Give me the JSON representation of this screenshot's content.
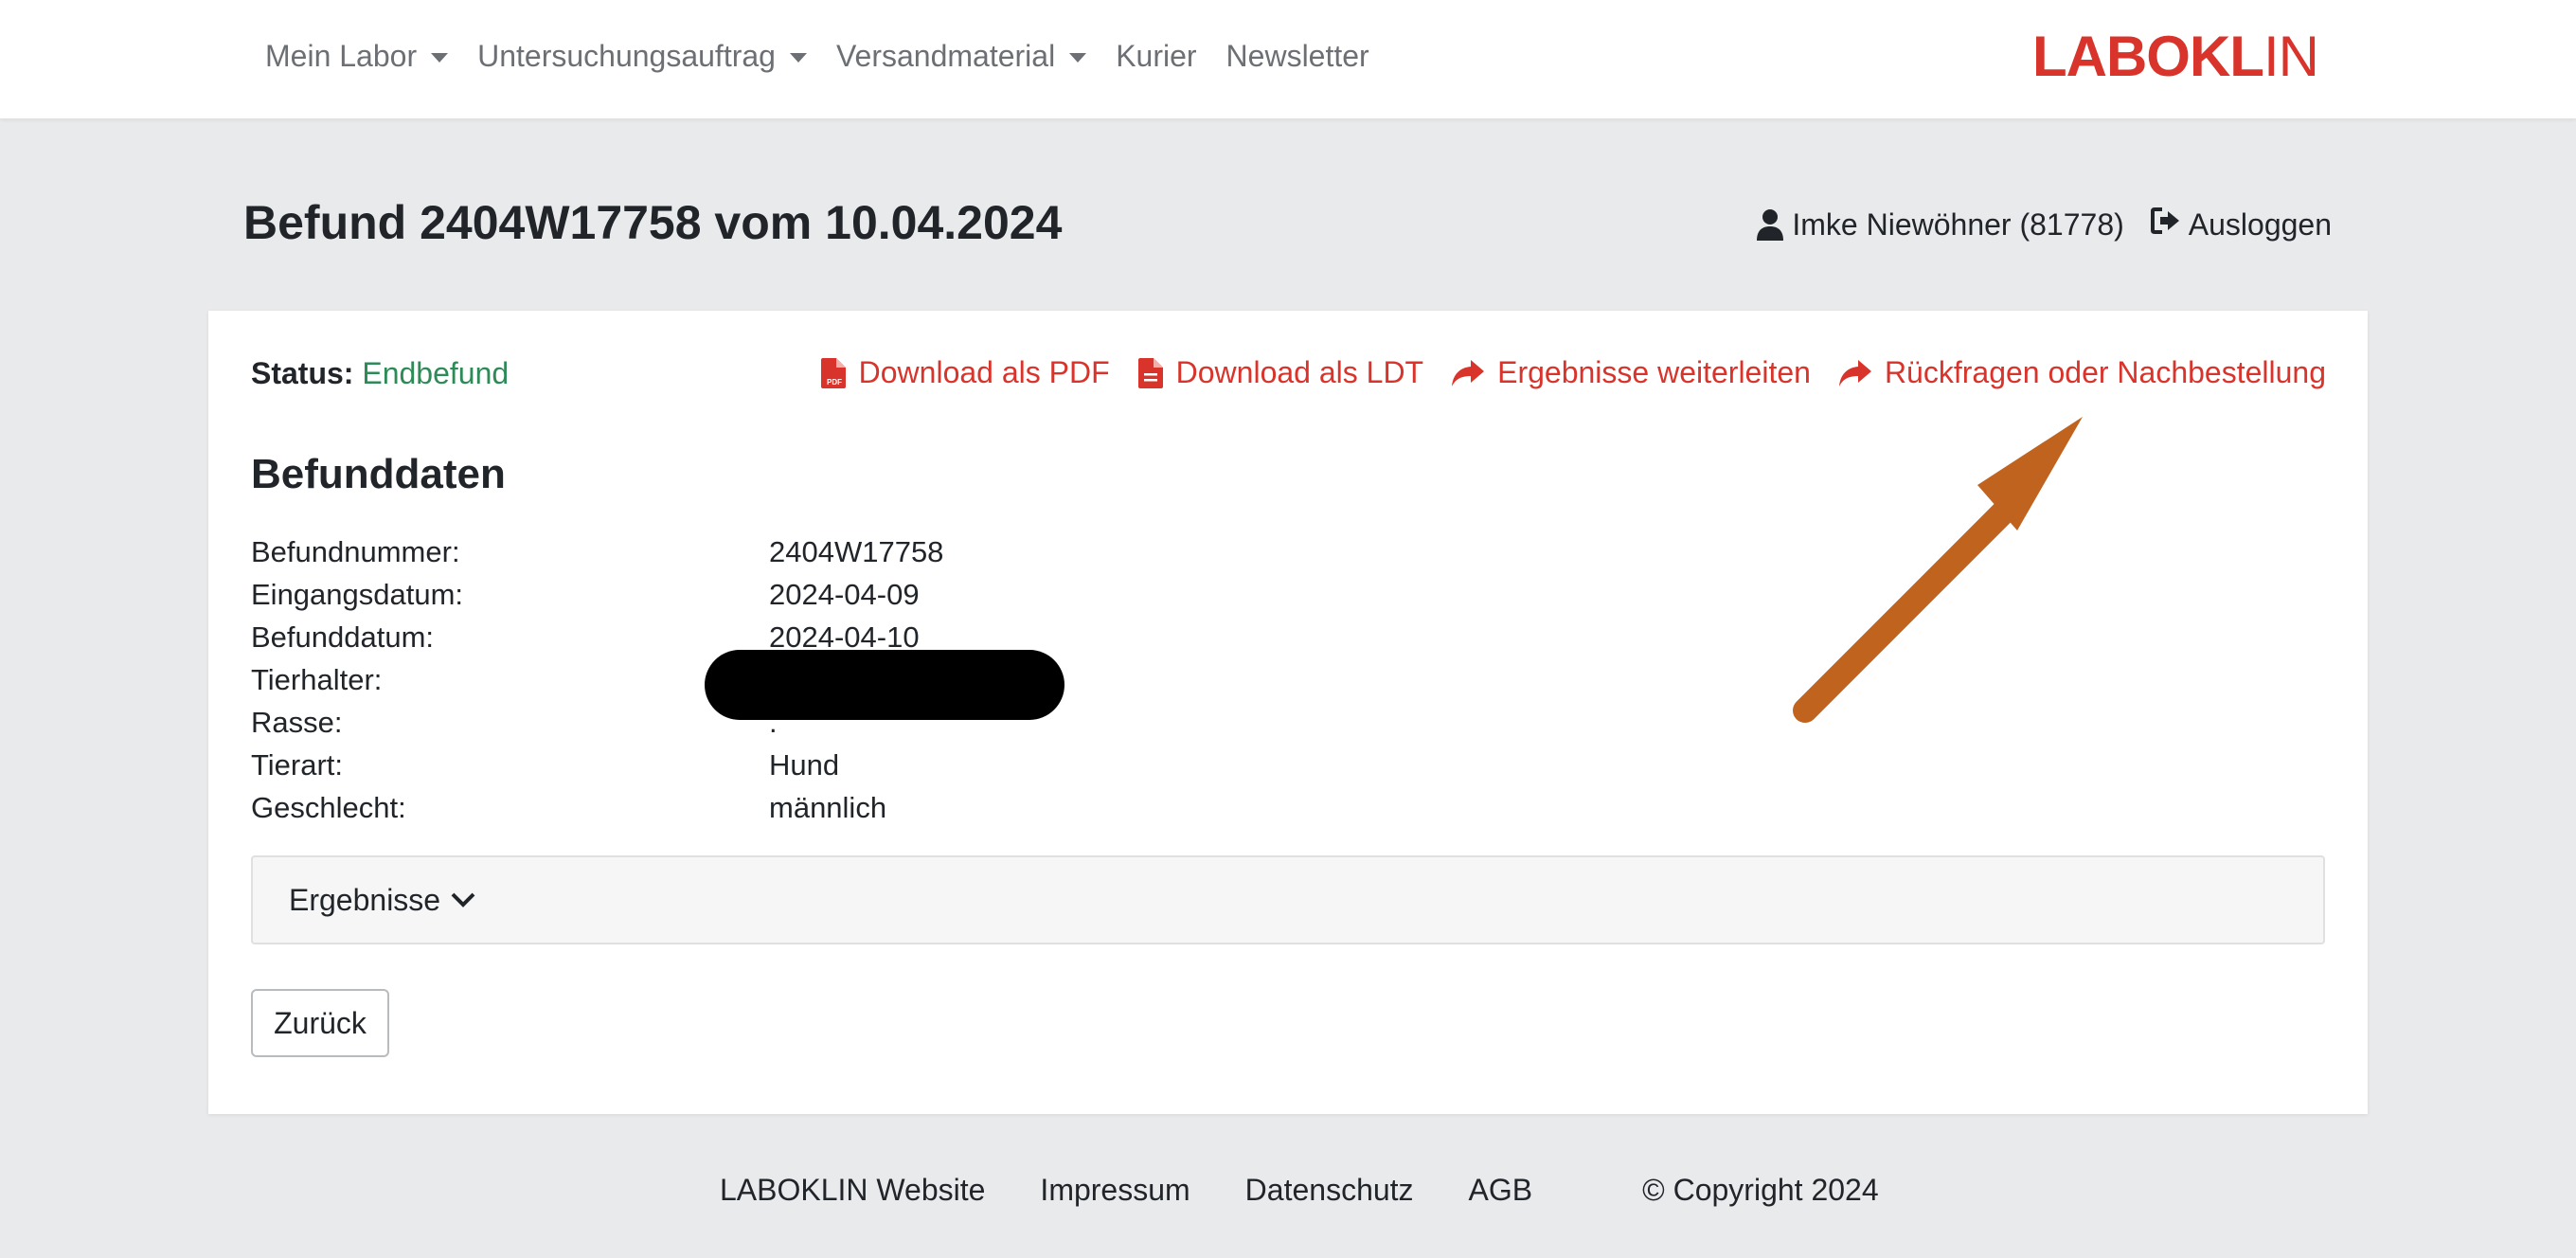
{
  "nav": {
    "items": [
      {
        "label": "Mein Labor",
        "dropdown": true
      },
      {
        "label": "Untersuchungsauftrag",
        "dropdown": true
      },
      {
        "label": "Versandmaterial",
        "dropdown": true
      },
      {
        "label": "Kurier",
        "dropdown": false
      },
      {
        "label": "Newsletter",
        "dropdown": false
      }
    ],
    "logo_bold": "LABOKL",
    "logo_thin": "IN"
  },
  "header": {
    "title": "Befund 2404W17758 vom 10.04.2024",
    "user": "Imke Niewöhner (81778)",
    "logout": "Ausloggen"
  },
  "card": {
    "status_label": "Status:",
    "status_value": "Endbefund",
    "actions": {
      "pdf": "Download als PDF",
      "ldt": "Download als LDT",
      "forward": "Ergebnisse weiterleiten",
      "inquiry": "Rückfragen oder Nachbestellung"
    },
    "section_title": "Befunddaten",
    "rows": [
      {
        "key": "Befundnummer:",
        "value": "2404W17758"
      },
      {
        "key": "Eingangsdatum:",
        "value": "2024-04-09"
      },
      {
        "key": "Befunddatum:",
        "value": "2024-04-10"
      },
      {
        "key": "Tierhalter:",
        "value": ""
      },
      {
        "key": "Rasse:",
        "value": "."
      },
      {
        "key": "Tierart:",
        "value": "Hund"
      },
      {
        "key": "Geschlecht:",
        "value": "männlich"
      }
    ],
    "results_label": "Ergebnisse",
    "back_label": "Zurück"
  },
  "footer": {
    "links": [
      "LABOKLIN Website",
      "Impressum",
      "Datenschutz",
      "AGB"
    ],
    "copyright": "© Copyright 2024"
  },
  "colors": {
    "accent_red": "#d9342b",
    "status_green": "#2e8b57",
    "annotation_arrow": "#c0631f"
  }
}
